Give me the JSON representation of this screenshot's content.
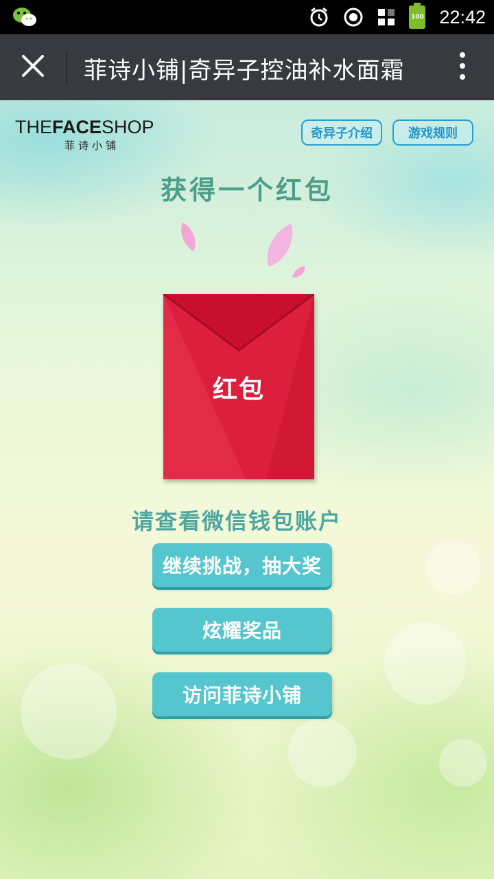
{
  "status_bar": {
    "time": "22:42",
    "battery": "100",
    "icons": [
      "wechat-icon",
      "alarm-icon",
      "sync-icon",
      "grid-icon",
      "battery-icon"
    ]
  },
  "title_bar": {
    "title": "菲诗小铺|奇异子控油补水面霜"
  },
  "logo": {
    "brand_light_1": "THE",
    "brand_bold": "FACE",
    "brand_light_2": "SHOP",
    "brand_cn": "菲诗小铺"
  },
  "top_buttons": {
    "intro": "奇异子介绍",
    "rules": "游戏规则"
  },
  "headline": "获得一个红包",
  "envelope_label": "红包",
  "notice": "请查看微信钱包账户",
  "actions": {
    "continue": "继续挑战，抽大奖",
    "show_prize": "炫耀奖品",
    "visit": "访问菲诗小铺"
  },
  "colors": {
    "accent_teal": "#56c6ce",
    "envelope_red": "#e0213f",
    "headline_green": "#4c9e8b",
    "title_bar": "#393a3f"
  }
}
